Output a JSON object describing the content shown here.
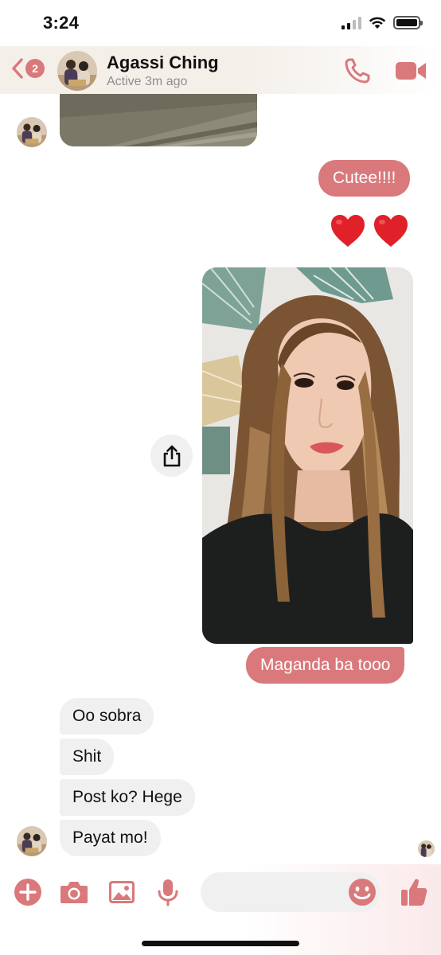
{
  "status_bar": {
    "time": "3:24"
  },
  "header": {
    "back_badge": "2",
    "contact_name": "Agassi Ching",
    "contact_status": "Active 3m ago"
  },
  "messages": {
    "cutee": "Cutee!!!!",
    "hearts": [
      "❤️",
      "❤️"
    ],
    "maganda": "Maganda ba tooo",
    "incoming": [
      "Oo sobra",
      "Shit",
      "Post ko? Hege",
      "Payat mo!"
    ]
  },
  "composer": {
    "input_value": ""
  },
  "colors": {
    "accent": "#d9797c",
    "incoming_bubble": "#f0f0f0"
  },
  "icons": [
    "chevron-left-icon",
    "phone-icon",
    "video-camera-icon",
    "share-icon",
    "plus-icon",
    "camera-icon",
    "image-icon",
    "microphone-icon",
    "emoji-icon",
    "thumbs-up-icon"
  ]
}
